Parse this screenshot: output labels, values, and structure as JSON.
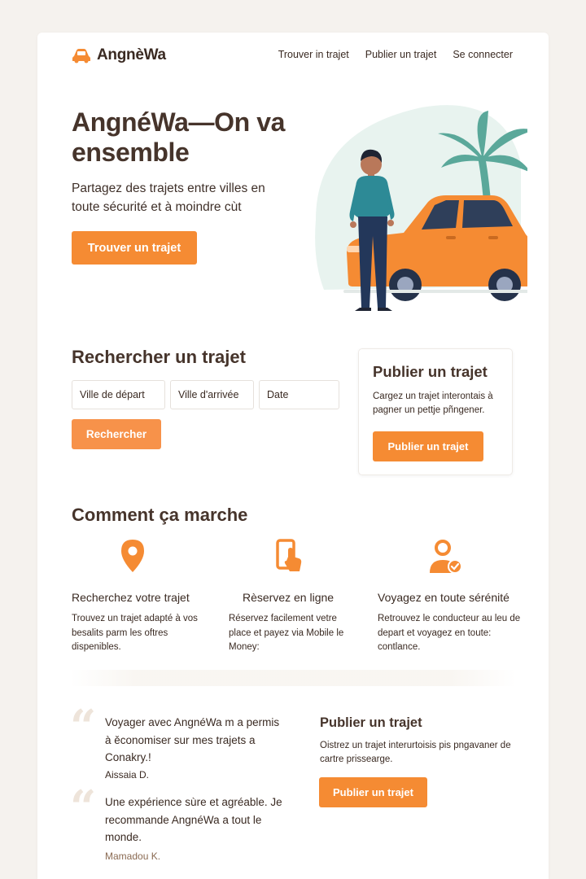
{
  "header": {
    "brand": "AngnèWa",
    "nav": [
      "Trouver in trajet",
      "Publier un trajet",
      "Se connecter"
    ]
  },
  "hero": {
    "title": "AngnéWa—On va ensemble",
    "subtitle": "Partagez des trajets entre villes en toute sécurité et à moindre cùt",
    "cta": "Trouver un trajet"
  },
  "search": {
    "title": "Rechercher un trajet",
    "fields": [
      "Ville de départ",
      "Ville d'arrivée",
      "Date"
    ],
    "button": "Rechercher"
  },
  "publish_card": {
    "title": "Publier un trajet",
    "text": "Cargez un trajet interontais à pagner un pettje pñngener.",
    "button": "Publier un trajet"
  },
  "how": {
    "title": "Comment ça marche",
    "steps": [
      {
        "icon": "location-pin-icon",
        "title": "Recherchez votre trajet",
        "text": "Trouvez un trajet adapté à vos besalits parm les oftres dispenibles."
      },
      {
        "icon": "phone-tap-icon",
        "title": "Rèservez en ligne",
        "text": "Réservez facilement vetre place et payez via Mobile le Money:"
      },
      {
        "icon": "user-check-icon",
        "title": "Voyagez en toute sérénité",
        "text": "Retrouvez le conducteur au leu de depart et voyagez en toute: contlance."
      }
    ]
  },
  "testimonials": [
    {
      "quote": "Voyager avec AngnéWa m a permis à ěconomiser sur mes trajets a Conakry.!",
      "author": "Aissaia D."
    },
    {
      "quote": "Une expérience sùre et agréable. Je recommande AngnéWa a tout le monde.",
      "author": "Mamadou K."
    }
  ],
  "publish_bottom": {
    "title": "Publier un trajet",
    "text": "Oistrez un trajet interurtoisis pis pngavaner de cartre prissearge.",
    "button": "Publier un trajet"
  },
  "colors": {
    "accent": "#f58b33",
    "text": "#3a2a22",
    "background": "#f5f2ee",
    "palm": "#5aa89a"
  }
}
